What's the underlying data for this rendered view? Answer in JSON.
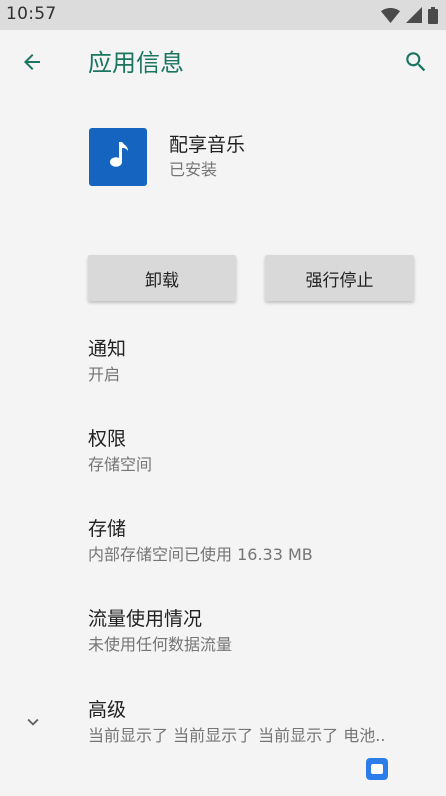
{
  "status_bar": {
    "time": "10:57",
    "icons": [
      "wifi-icon",
      "signal-icon",
      "battery-icon"
    ]
  },
  "app_bar": {
    "title": "应用信息",
    "back_icon": "arrow-back-icon",
    "search_icon": "search-icon",
    "accent_color": "#1b7560"
  },
  "app": {
    "name": "配享音乐",
    "status": "已安装",
    "icon": "music-note-icon",
    "icon_color": "#1565c0"
  },
  "actions": {
    "uninstall_label": "卸载",
    "force_stop_label": "强行停止"
  },
  "settings": [
    {
      "title": "通知",
      "summary": "开启"
    },
    {
      "title": "权限",
      "summary": "存储空间"
    },
    {
      "title": "存储",
      "summary": "内部存储空间已使用 16.33 MB"
    },
    {
      "title": "流量使用情况",
      "summary": "未使用任何数据流量"
    },
    {
      "title": "高级",
      "summary": "当前显示了 当前显示了 当前显示了 电池..",
      "icon": "chevron-down-icon"
    }
  ]
}
